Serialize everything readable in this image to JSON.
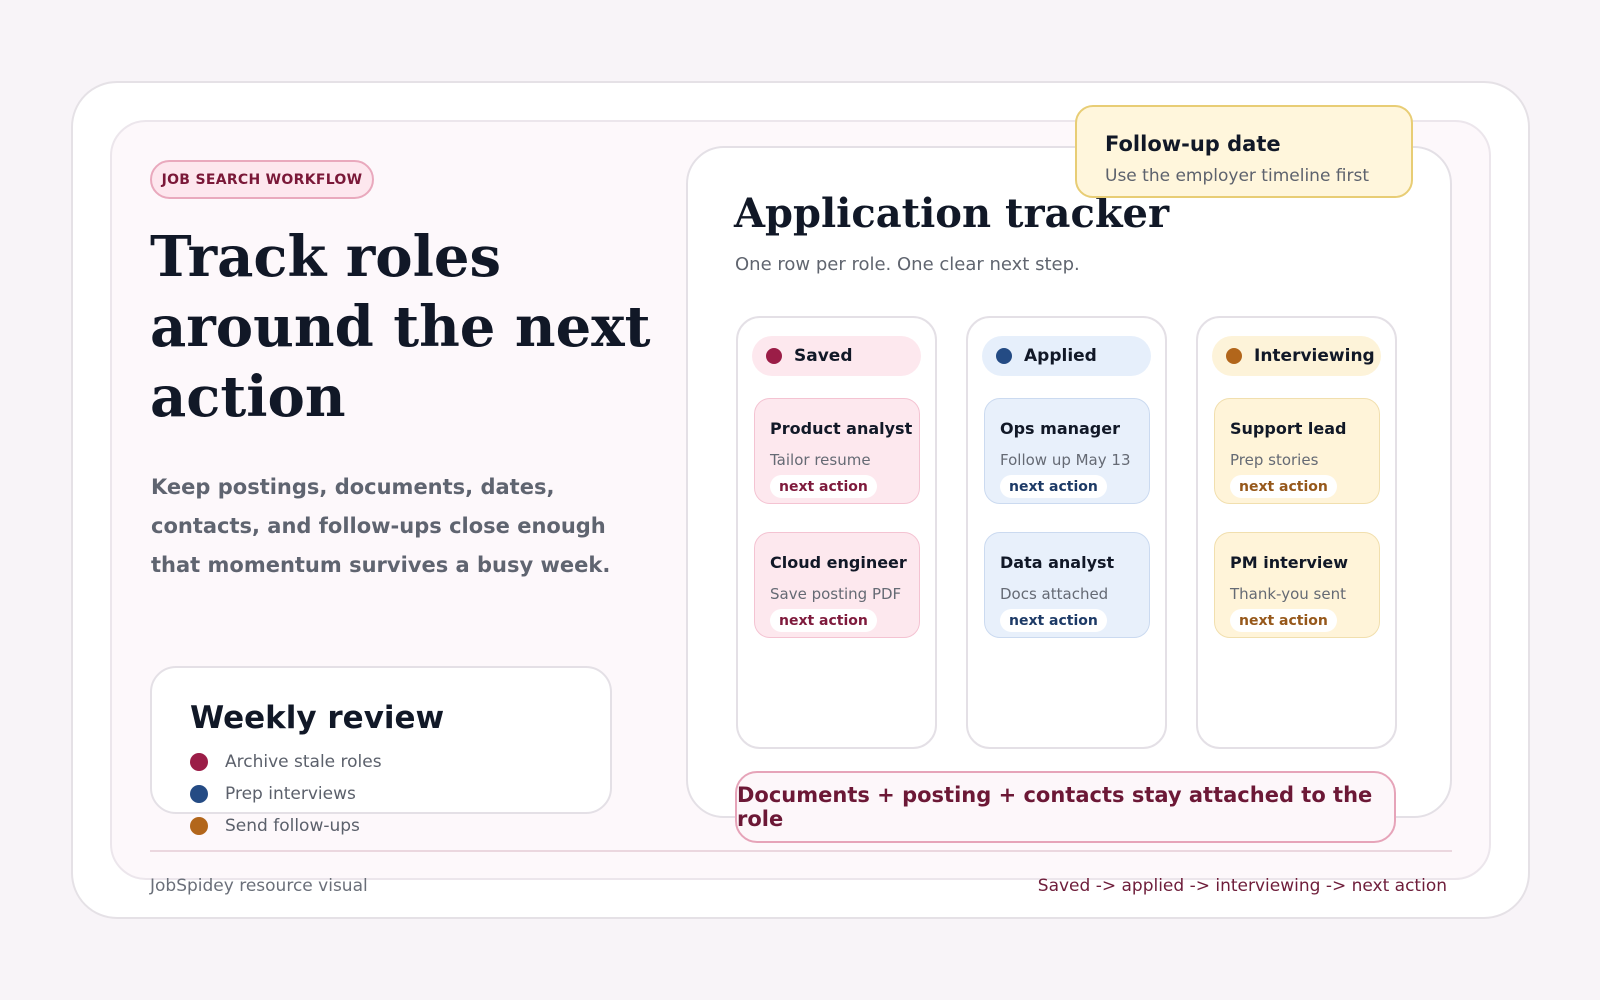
{
  "hero": {
    "tag": "JOB SEARCH WORKFLOW",
    "title": "Track roles around the next action",
    "description": "Keep postings, documents, dates, contacts, and follow-ups close enough that momentum survives a busy week."
  },
  "weekly_review": {
    "title": "Weekly review",
    "items": [
      {
        "label": "Archive stale roles",
        "color": "#9b1d47"
      },
      {
        "label": "Prep interviews",
        "color": "#244b84"
      },
      {
        "label": "Send follow-ups",
        "color": "#b2661b"
      }
    ]
  },
  "tracker": {
    "title": "Application tracker",
    "subtitle": "One row per role. One clear next step.",
    "followup": {
      "title": "Follow-up date",
      "subtitle": "Use the employer timeline first"
    },
    "columns": [
      {
        "label": "Saved",
        "dot_color": "#9b1d47",
        "head_bg": "#fde8ee",
        "card_bg": "#fde8ee",
        "card_border": "#f4c3d2",
        "badge_color": "#7e1a3c",
        "cards": [
          {
            "title": "Product analyst",
            "subtitle": "Tailor resume",
            "badge": "next action"
          },
          {
            "title": "Cloud engineer",
            "subtitle": "Save posting PDF",
            "badge": "next action"
          }
        ]
      },
      {
        "label": "Applied",
        "dot_color": "#244b84",
        "head_bg": "#e6effb",
        "card_bg": "#e8f0fb",
        "card_border": "#cbdaf0",
        "badge_color": "#1d3a66",
        "cards": [
          {
            "title": "Ops manager",
            "subtitle": "Follow up May 13",
            "badge": "next action"
          },
          {
            "title": "Data analyst",
            "subtitle": "Docs attached",
            "badge": "next action"
          }
        ]
      },
      {
        "label": "Interviewing",
        "dot_color": "#b2661b",
        "head_bg": "#fdf3d9",
        "card_bg": "#fff4d9",
        "card_border": "#f1dfae",
        "badge_color": "#96581b",
        "cards": [
          {
            "title": "Support lead",
            "subtitle": "Prep stories",
            "badge": "next action"
          },
          {
            "title": "PM interview",
            "subtitle": "Thank-you sent",
            "badge": "next action"
          }
        ]
      }
    ],
    "banner": "Documents + posting + contacts stay attached to the role"
  },
  "footer": {
    "left": "JobSpidey resource visual",
    "right": "Saved -> applied -> interviewing -> next action"
  }
}
